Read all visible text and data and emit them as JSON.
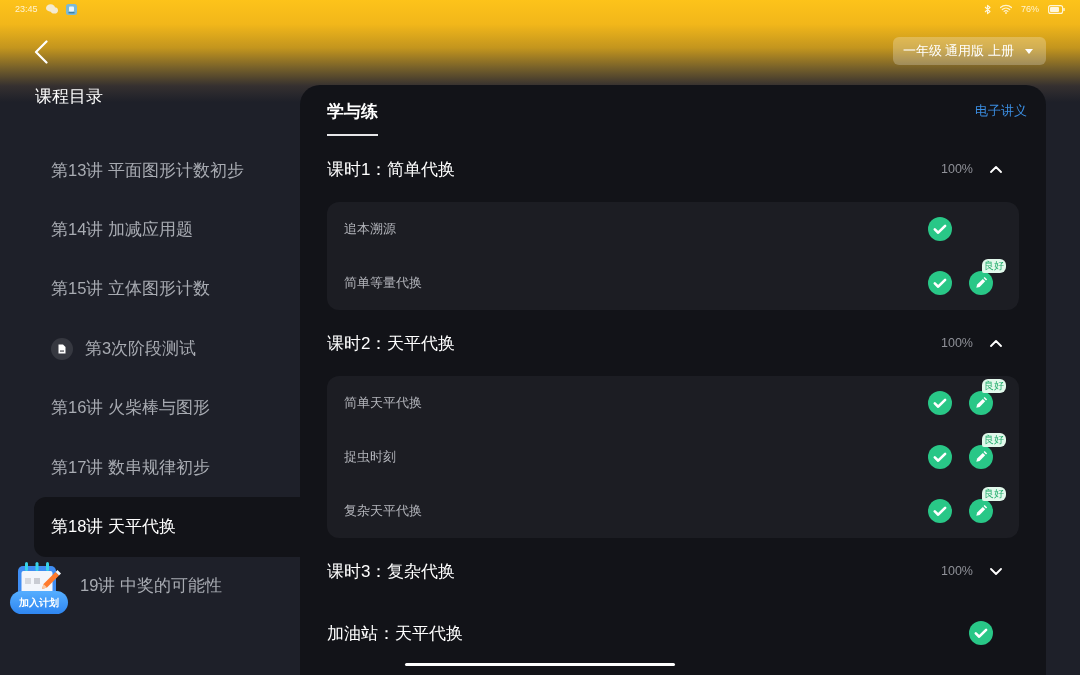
{
  "status_bar": {
    "time": "23:45",
    "battery": "76%"
  },
  "header": {
    "grade_selector": "一年级 通用版 上册"
  },
  "sidebar": {
    "title": "课程目录",
    "items": [
      {
        "label": "第13讲 平面图形计数初步",
        "kind": "lesson",
        "selected": false
      },
      {
        "label": "第14讲 加减应用题",
        "kind": "lesson",
        "selected": false
      },
      {
        "label": "第15讲 立体图形计数",
        "kind": "lesson",
        "selected": false
      },
      {
        "label": "第3次阶段测试",
        "kind": "test",
        "selected": false
      },
      {
        "label": "第16讲 火柴棒与图形",
        "kind": "lesson",
        "selected": false
      },
      {
        "label": "第17讲 数串规律初步",
        "kind": "lesson",
        "selected": false
      },
      {
        "label": "第18讲 天平代换",
        "kind": "lesson",
        "selected": true
      },
      {
        "label": "19讲 中奖的可能性",
        "kind": "lesson",
        "selected": false
      }
    ]
  },
  "plan_button": {
    "label": "加入计划"
  },
  "panel": {
    "tabs": [
      {
        "label": "学与练",
        "selected": true
      }
    ],
    "handout_link": "电子讲义",
    "sections": [
      {
        "title": "课时1：简单代换",
        "progress": "100%",
        "expanded": true,
        "items": [
          {
            "label": "追本溯源",
            "done": true,
            "exercise": false
          },
          {
            "label": "简单等量代换",
            "done": true,
            "exercise": true,
            "grade": "良好"
          }
        ]
      },
      {
        "title": "课时2：天平代换",
        "progress": "100%",
        "expanded": true,
        "items": [
          {
            "label": "简单天平代换",
            "done": true,
            "exercise": true,
            "grade": "良好"
          },
          {
            "label": "捉虫时刻",
            "done": true,
            "exercise": true,
            "grade": "良好"
          },
          {
            "label": "复杂天平代换",
            "done": true,
            "exercise": true,
            "grade": "良好"
          }
        ]
      },
      {
        "title": "课时3：复杂代换",
        "progress": "100%",
        "expanded": false
      }
    ],
    "extra": {
      "title": "加油站：天平代换",
      "done": true
    }
  }
}
